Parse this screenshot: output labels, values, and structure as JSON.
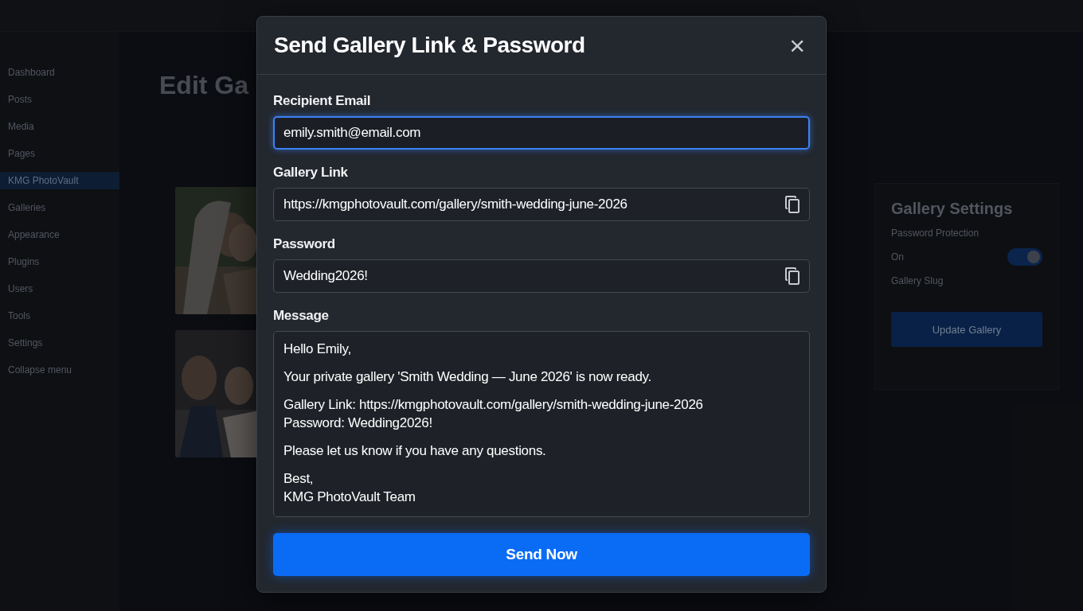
{
  "backdrop": {
    "sidebar": {
      "items": [
        {
          "label": "Dashboard",
          "selected": false
        },
        {
          "label": "Posts",
          "selected": false
        },
        {
          "label": "Media",
          "selected": false
        },
        {
          "label": "Pages",
          "selected": false
        },
        {
          "label": "KMG PhotoVault",
          "selected": true
        },
        {
          "label": "Galleries",
          "selected": false
        },
        {
          "label": "Appearance",
          "selected": false
        },
        {
          "label": "Plugins",
          "selected": false
        },
        {
          "label": "Users",
          "selected": false
        },
        {
          "label": "Tools",
          "selected": false
        },
        {
          "label": "Settings",
          "selected": false
        },
        {
          "label": "Collapse menu",
          "selected": false
        }
      ]
    },
    "page_title": "Edit Ga",
    "settings": {
      "title": "Gallery Settings",
      "password_label": "Password Protection",
      "password_state": "On",
      "password_on": true,
      "slug_label": "Gallery Slug",
      "button": "Update Gallery"
    }
  },
  "dialog": {
    "title": "Send Gallery Link & Password",
    "close": "×",
    "fields": [
      {
        "kind": "input",
        "label": "Recipient Email",
        "value": "emily.smith@email.com",
        "focused": true
      },
      {
        "kind": "copy",
        "label": "Gallery Link",
        "value": "https://kmgphotovault.com/gallery/smith-wedding-june-2026",
        "focused": false
      },
      {
        "kind": "copy",
        "label": "Password",
        "value": "Wedding2026!",
        "focused": false
      },
      {
        "kind": "textarea",
        "label": "Message",
        "focused": false,
        "paragraphs": [
          "Hello Emily,",
          "Your private gallery 'Smith Wedding — June 2026' is now ready.",
          "Gallery Link: https://kmgphotovault.com/gallery/smith-wedding-june-2026\nPassword: Wedding2026!",
          "Please let us know if you have any questions.",
          "Best,\nKMG PhotoVault Team"
        ]
      }
    ],
    "button": "Send Now"
  }
}
